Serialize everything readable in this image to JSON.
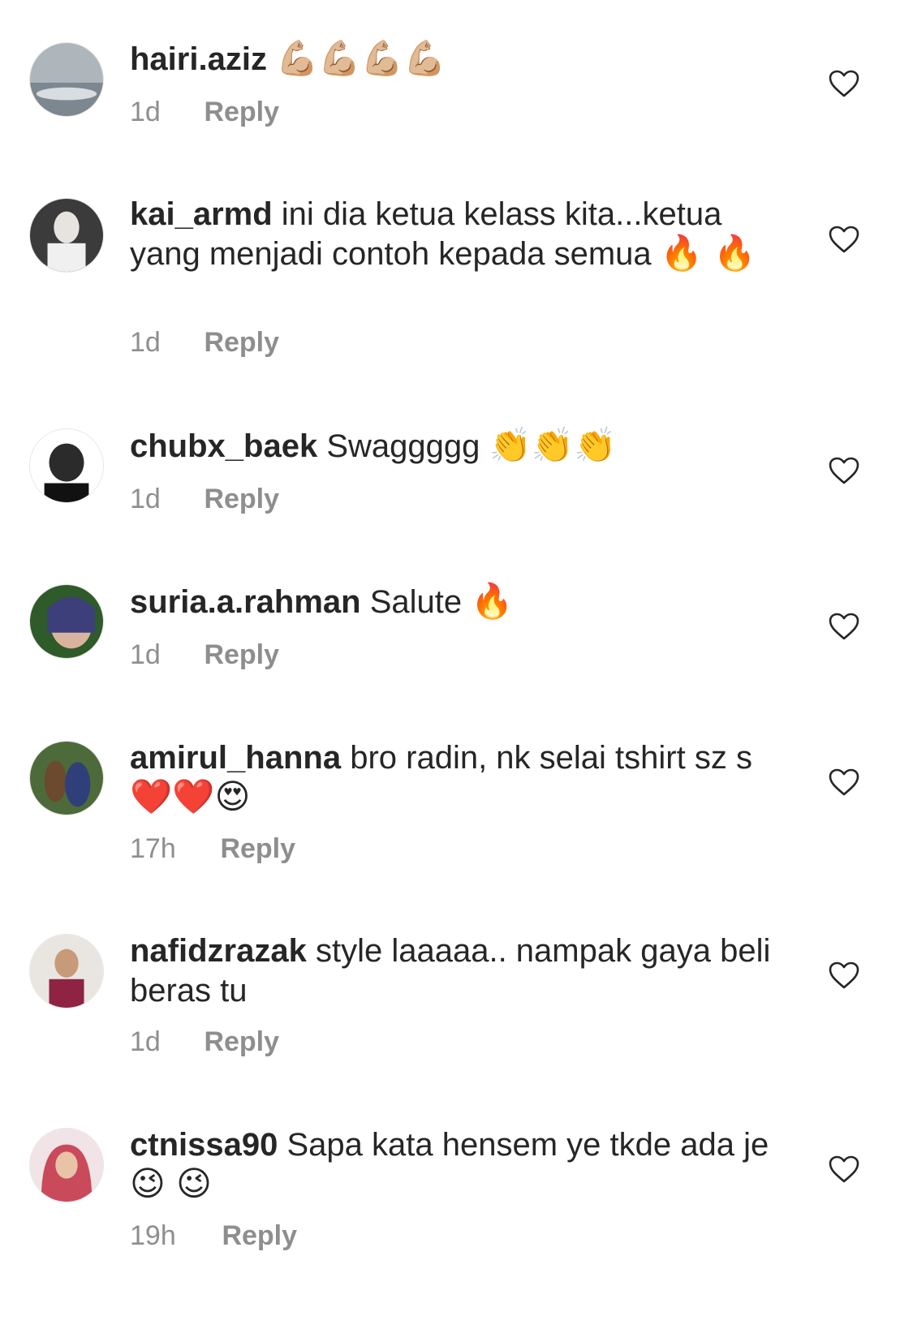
{
  "reply_label": "Reply",
  "comments": [
    {
      "username": "hairi.aziz",
      "text": "",
      "emoji": "💪🏼💪🏼💪🏼💪🏼",
      "time": "1d"
    },
    {
      "username": "kai_armd",
      "text": "ini dia ketua kelass kita...ketua yang menjadi contoh kepada semua",
      "emoji": "🔥 🔥",
      "time": "1d"
    },
    {
      "username": "chubx_baek",
      "text": "Swaggggg",
      "emoji": "👏👏👏",
      "time": "1d"
    },
    {
      "username": "suria.a.rahman",
      "text": "Salute",
      "emoji": "🔥",
      "time": "1d"
    },
    {
      "username": "amirul_hanna",
      "text": "bro radin, nk selai tshirt sz s",
      "emoji": "❤️❤️😍",
      "time": "17h"
    },
    {
      "username": "nafidzrazak",
      "text": "style laaaaa.. nampak gaya beli beras tu",
      "emoji": "",
      "time": "1d"
    },
    {
      "username": "ctnissa90",
      "text": "Sapa kata hensem ye tkde ada je",
      "emoji": "😉 😉",
      "time": "19h"
    }
  ]
}
